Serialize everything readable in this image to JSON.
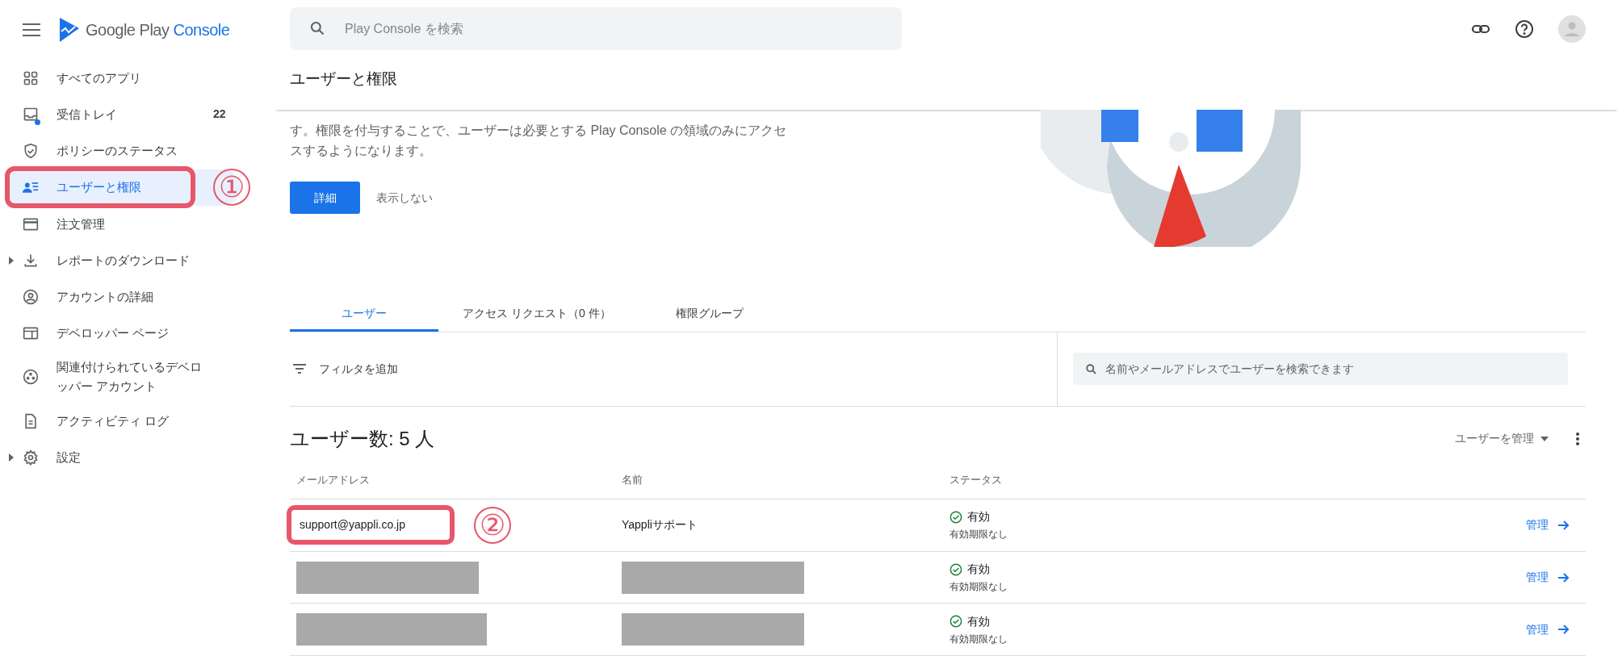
{
  "app": {
    "logo_text": "Google Play",
    "logo_accent": "Console"
  },
  "search": {
    "placeholder": "Play Console を検索"
  },
  "sidebar": {
    "items": [
      {
        "label": "すべてのアプリ",
        "selected": false
      },
      {
        "label": "受信トレイ",
        "selected": false,
        "count": "22",
        "unread": true
      },
      {
        "label": "ポリシーのステータス",
        "selected": false
      },
      {
        "label": "ユーザーと権限",
        "selected": true,
        "callout": "①"
      },
      {
        "label": "注文管理",
        "selected": false
      },
      {
        "label": "レポートのダウンロード",
        "selected": false,
        "expandable": true
      },
      {
        "label": "アカウントの詳細",
        "selected": false
      },
      {
        "label": "デベロッパー ページ",
        "selected": false
      },
      {
        "label": "関連付けられているデベロッパー アカウント",
        "selected": false
      },
      {
        "label": "アクティビティ ログ",
        "selected": false
      },
      {
        "label": "設定",
        "selected": false,
        "expandable": true
      }
    ]
  },
  "page": {
    "title": "ユーザーと権限",
    "banner": {
      "lines": [
        "す。権限を付与することで、ユーザーは必要とする Play Console の領域のみにアクセ",
        "スするようになります。"
      ],
      "primary_button": "詳細",
      "secondary_button": "表示しない"
    }
  },
  "tabs": [
    {
      "label": "ユーザー",
      "selected": true
    },
    {
      "label": "アクセス リクエスト（0 件）",
      "selected": false
    },
    {
      "label": "権限グループ",
      "selected": false
    }
  ],
  "filter": {
    "label": "フィルタを追加"
  },
  "user_search": {
    "placeholder": "名前やメールアドレスでユーザーを検索できます"
  },
  "table": {
    "heading": "ユーザー数: 5 人",
    "manage_menu": "ユーザーを管理",
    "columns": [
      "メールアドレス",
      "名前",
      "ステータス"
    ],
    "rows": [
      {
        "kind": "visible",
        "email": "support@yappli.co.jp",
        "name": "Yappliサポート",
        "status": "有効",
        "expiry": "有効期限なし",
        "action": "管理",
        "callout": "②"
      },
      {
        "kind": "redacted",
        "status": "有効",
        "expiry": "有効期限なし",
        "action": "管理"
      },
      {
        "kind": "redacted",
        "status": "有効",
        "expiry": "有効期限なし",
        "action": "管理"
      }
    ]
  }
}
